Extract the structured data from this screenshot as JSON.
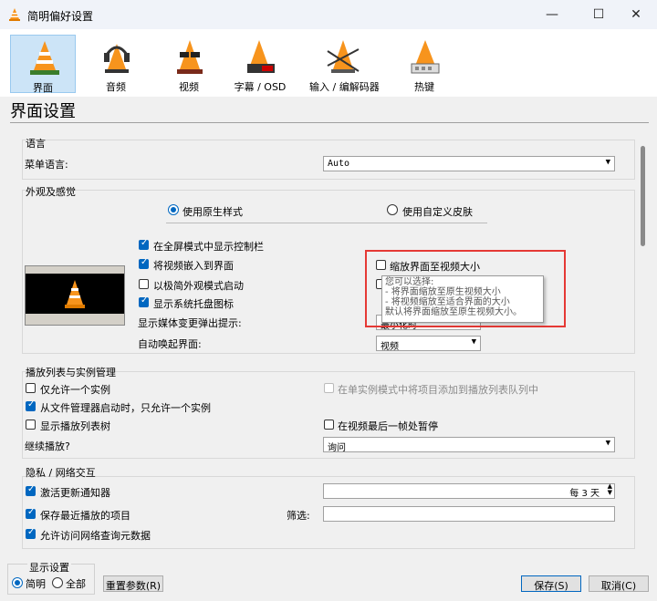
{
  "window": {
    "title": "简明偏好设置"
  },
  "categories": [
    {
      "label": "界面",
      "icon": "cone-interface-icon"
    },
    {
      "label": "音频",
      "icon": "cone-headphones-icon"
    },
    {
      "label": "视频",
      "icon": "cone-glasses-icon"
    },
    {
      "label": "字幕 / OSD",
      "icon": "cone-clapper-icon"
    },
    {
      "label": "输入 / 编解码器",
      "icon": "cone-cable-icon"
    },
    {
      "label": "热键",
      "icon": "cone-keyboard-icon"
    }
  ],
  "page_title": "界面设置",
  "language": {
    "group": "语言",
    "menu_label": "菜单语言:",
    "menu_value": "Auto"
  },
  "look": {
    "group": "外观及感觉",
    "native_style": "使用原生样式",
    "custom_skin": "使用自定义皮肤",
    "fullscreen_controls": "在全屏模式中显示控制栏",
    "embed_video": "将视频嵌入到界面",
    "minimal_start": "以极简外观模式启动",
    "systray": "显示系统托盘图标",
    "popup_label": "显示媒体变更弹出提示:",
    "popup_value": "最小化时",
    "raise_label": "自动唤起界面:",
    "raise_value": "视频",
    "resize": "缩放界面至视频大小",
    "tooltip": {
      "line1": "您可以选择:",
      "line2": " - 将界面缩放至原生视频大小",
      "line3": " - 将视频缩放至适合界面的大小",
      "line4": "默认将界面缩放至原生视频大小。"
    }
  },
  "playlist": {
    "group": "播放列表与实例管理",
    "one_instance": "仅允许一个实例",
    "one_instance_fm": "从文件管理器启动时，只允许一个实例",
    "enqueue": "在单实例模式中将项目添加到播放列表队列中",
    "tree": "显示播放列表树",
    "pause_last": "在视频最后一帧处暂停",
    "continue_label": "继续播放?",
    "continue_value": "询问"
  },
  "privacy": {
    "group": "隐私 / 网络交互",
    "update": "激活更新通知器",
    "update_every": "每 3 天",
    "recent": "保存最近播放的项目",
    "filter_label": "筛选:",
    "metadata": "允许访问网络查询元数据"
  },
  "footer": {
    "show_settings": "显示设置",
    "simple": "简明",
    "all": "全部",
    "reset": "重置参数(R)",
    "save": "保存(S)",
    "cancel": "取消(C)"
  },
  "colors": {
    "accent": "#0067c0",
    "highlight": "#e53935"
  }
}
